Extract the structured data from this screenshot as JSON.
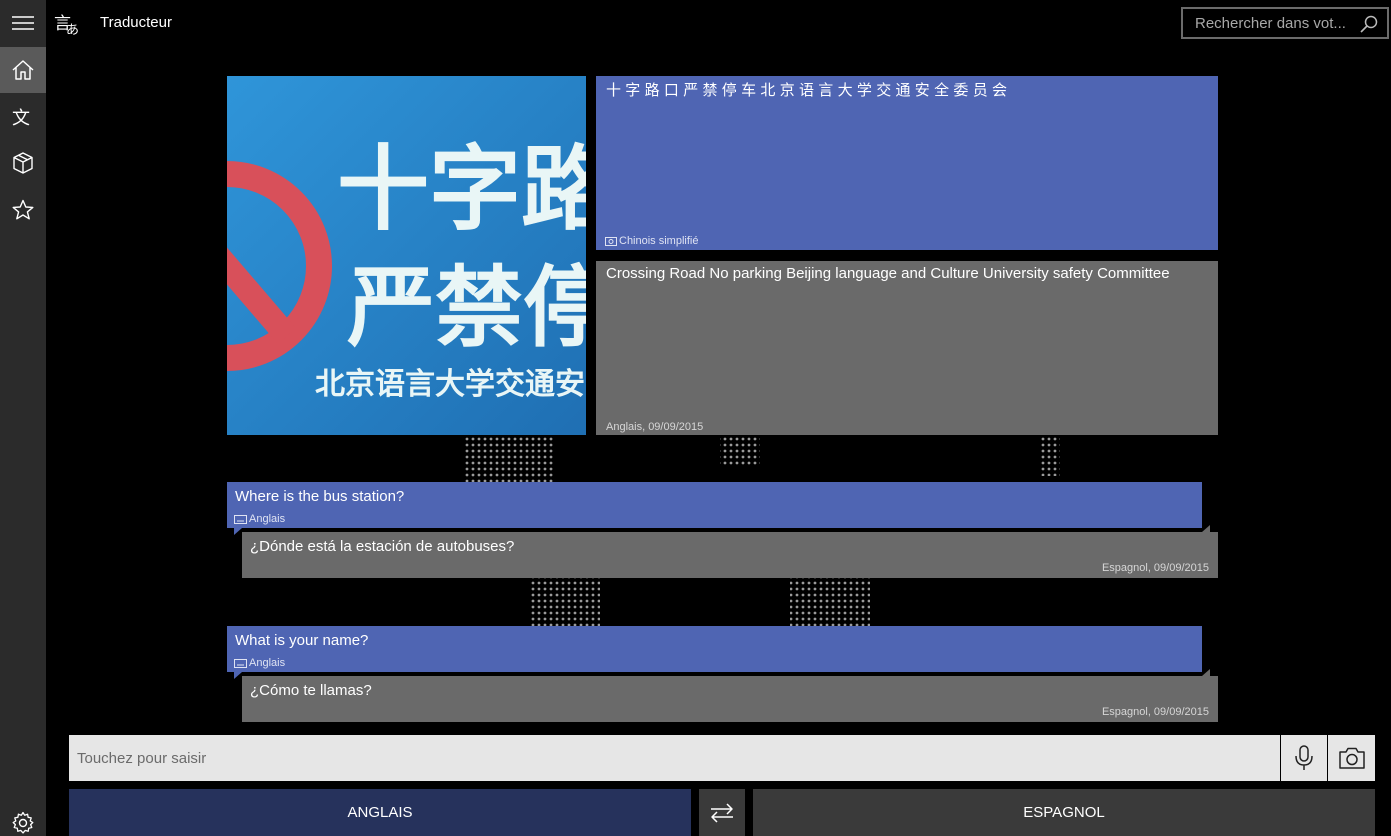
{
  "app": {
    "title": "Traducteur"
  },
  "search": {
    "placeholder": "Rechercher dans vot..."
  },
  "nav": {
    "items": [
      {
        "icon": "menu-icon"
      },
      {
        "icon": "home-icon"
      },
      {
        "icon": "translate-icon"
      },
      {
        "icon": "package-icon"
      },
      {
        "icon": "star-icon"
      },
      {
        "icon": "gear-icon"
      }
    ]
  },
  "photo_card": {
    "ocr_text": "十字路口严禁停车北京语言大学交通安全委员会",
    "ocr_language": "Chinois simplifié",
    "translation": "Crossing Road No parking Beijing language and Culture University safety Committee",
    "translation_meta": "Anglais, 09/09/2015",
    "sign_lines": [
      "十字路",
      "严禁停",
      "北京语言大学交通安"
    ]
  },
  "conversation": [
    {
      "source_text": "Where is the bus station?",
      "source_language": "Anglais",
      "target_text": "¿Dónde está la estación de autobuses?",
      "target_meta": "Espagnol, 09/09/2015"
    },
    {
      "source_text": "What is your name?",
      "source_language": "Anglais",
      "target_text": "¿Cómo te llamas?",
      "target_meta": "Espagnol, 09/09/2015"
    }
  ],
  "input": {
    "placeholder": "Touchez pour saisir"
  },
  "languages": {
    "from": "ANGLAIS",
    "to": "ESPAGNOL"
  },
  "colors": {
    "accent": "#4f65b3",
    "translation_bg": "#6a6a6a",
    "from_lang_bg": "#26325c"
  }
}
